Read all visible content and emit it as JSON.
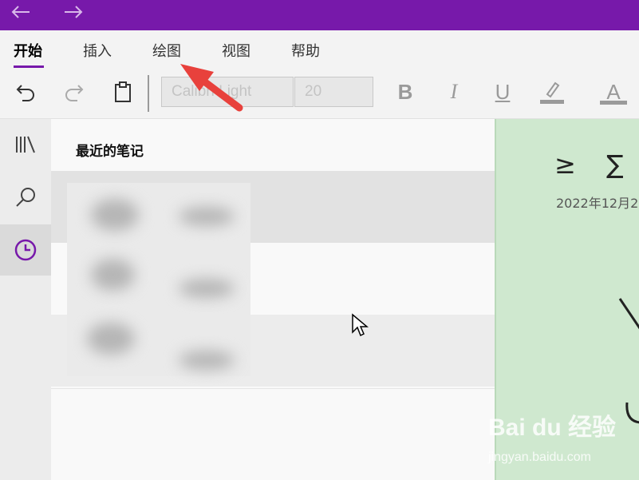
{
  "titlebar": {
    "back_icon": "back-arrow-icon",
    "forward_icon": "forward-arrow-icon",
    "color": "#7719aa"
  },
  "ribbon": {
    "tabs": [
      {
        "label": "开始",
        "active": true
      },
      {
        "label": "插入"
      },
      {
        "label": "绘图"
      },
      {
        "label": "视图"
      },
      {
        "label": "帮助"
      }
    ]
  },
  "toolbar": {
    "font_name": "Calibri Light",
    "font_size": "20",
    "bold": "B",
    "italic": "I",
    "underline": "U",
    "font_color": "A"
  },
  "list": {
    "header": "最近的笔记"
  },
  "page": {
    "symbols": [
      "≥",
      "∑"
    ],
    "date": "2022年12月2"
  },
  "watermark": {
    "main": "Bai du 经验",
    "sub": "jingyan.baidu.com"
  },
  "colors": {
    "accent": "#7719aa",
    "annotation_arrow": "#e8413c",
    "page_bg": "#cfe8cf"
  }
}
